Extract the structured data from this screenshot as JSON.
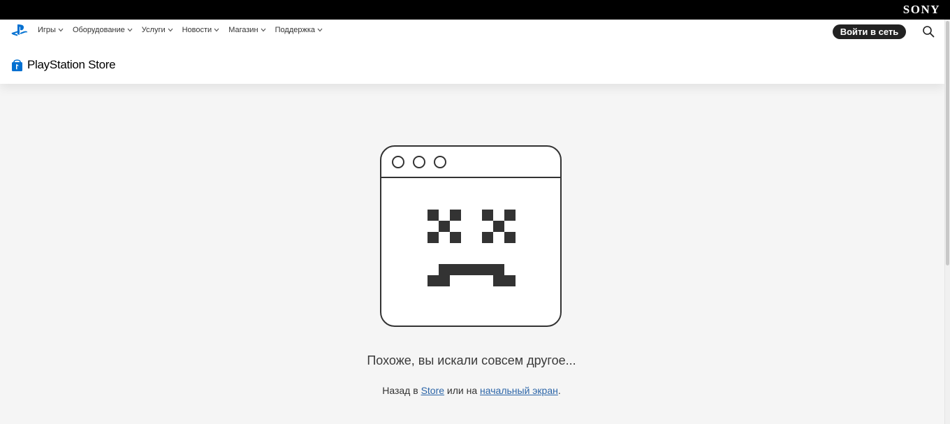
{
  "sony_bar": {
    "logo": "SONY"
  },
  "nav": {
    "items": [
      {
        "label": "Игры"
      },
      {
        "label": "Оборудование"
      },
      {
        "label": "Услуги"
      },
      {
        "label": "Новости"
      },
      {
        "label": "Магазин"
      },
      {
        "label": "Поддержка"
      }
    ]
  },
  "header": {
    "login_label": "Войти в сеть",
    "store_name": "PlayStation Store"
  },
  "error": {
    "title": "Похоже, вы искали совсем другое...",
    "back_prefix": "Назад в",
    "store_link": "Store",
    "middle": "или на",
    "home_link": "начальный экран",
    "suffix": "."
  },
  "colors": {
    "top_bar": "#000000",
    "link": "#2d66a8",
    "button_bg": "#222222",
    "page_bg": "#f5f5f5"
  }
}
